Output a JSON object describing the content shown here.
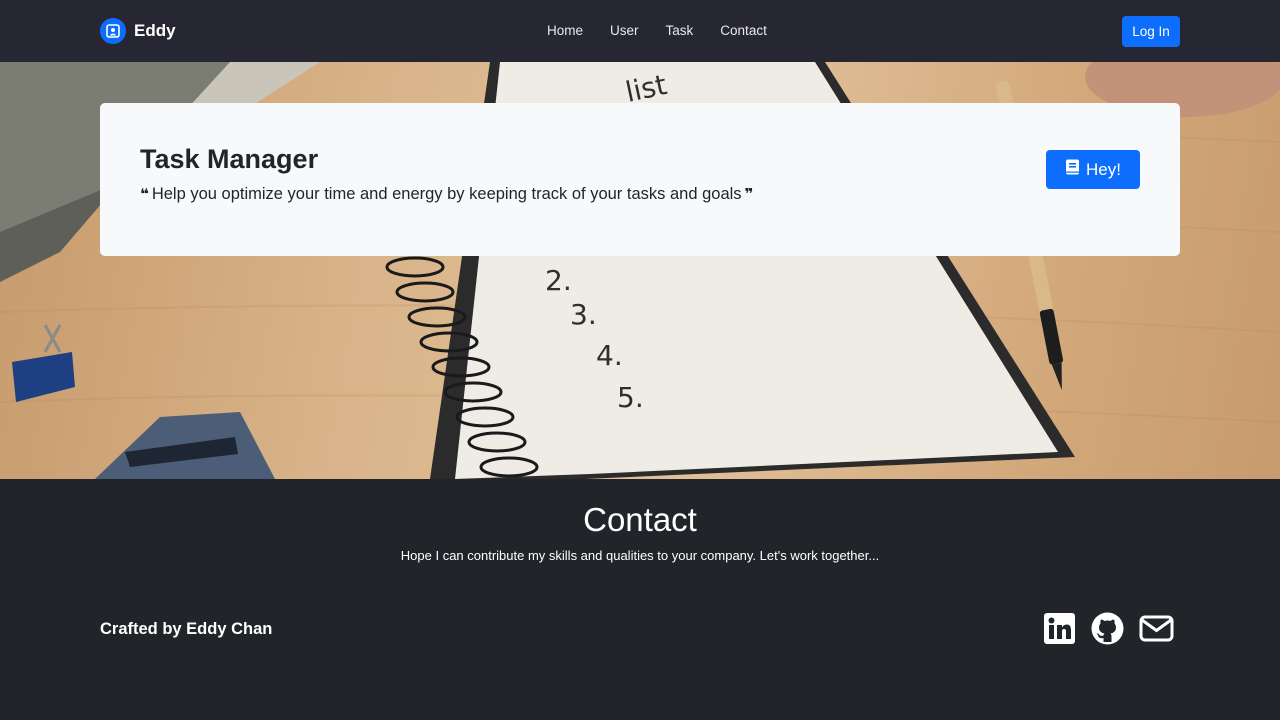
{
  "navbar": {
    "brand": "Eddy",
    "links": [
      "Home",
      "User",
      "Task",
      "Contact"
    ],
    "login_label": "Log In"
  },
  "hero": {
    "title": "Task Manager",
    "subtitle": "Help you optimize your time and energy by keeping track of your tasks and goals",
    "button_label": "Hey!",
    "notepad_text": [
      "list",
      "2.",
      "3.",
      "4.",
      "5."
    ]
  },
  "footer": {
    "title": "Contact",
    "text": "Hope I can contribute my skills and qualities to your company. Let's work together...",
    "credit": "Crafted by Eddy Chan",
    "social_icons": [
      "linkedin-icon",
      "github-icon",
      "envelope-icon"
    ]
  },
  "colors": {
    "navbar_bg": "#272734",
    "footer_bg": "#212529",
    "primary": "#0d6efd",
    "card_bg": "#f8f9fa"
  }
}
